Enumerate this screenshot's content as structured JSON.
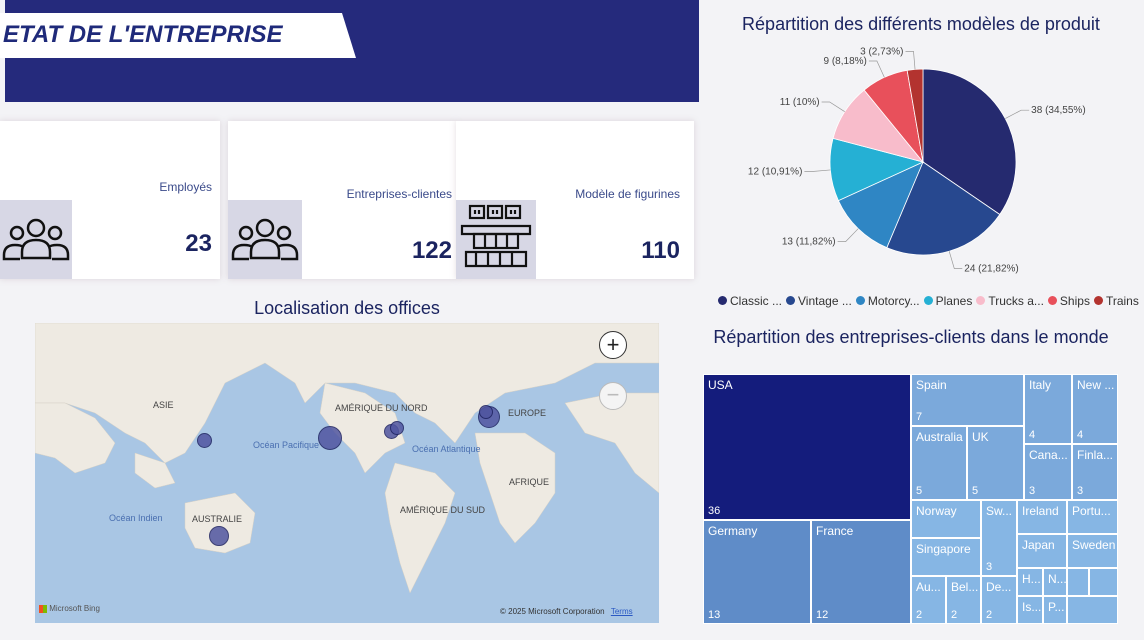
{
  "header": {
    "title": "ETAT DE L'ENTREPRISE"
  },
  "kpis": [
    {
      "label": "Employés",
      "value": "23",
      "icon": "people-icon"
    },
    {
      "label": "Entreprises-clientes",
      "value": "122",
      "icon": "people-icon"
    },
    {
      "label": "Modèle de figurines",
      "value": "110",
      "icon": "product-boxes-icon"
    }
  ],
  "map": {
    "title": "Localisation des offices",
    "labels": {
      "asie": "ASIE",
      "amerique_nord": "AMÉRIQUE DU NORD",
      "europe": "EUROPE",
      "afrique": "AFRIQUE",
      "amerique_sud": "AMÉRIQUE DU SUD",
      "australie": "AUSTRALIE",
      "ocean_pacifique": "Océan Pacifique",
      "ocean_atlantique": "Océan Atlantique",
      "ocean_indien": "Océan Indien"
    },
    "logo": "Microsoft Bing",
    "copyright": "© 2025 Microsoft Corporation",
    "terms": "Terms"
  },
  "pie": {
    "title": "Répartition des différents modèles de produit",
    "legend_colors": [
      "#252a6f",
      "#27488f",
      "#2f86c4",
      "#25b0d4",
      "#f8bccb",
      "#e8505b",
      "#b3332f"
    ]
  },
  "treemap": {
    "title": "Répartition des entreprises-clients dans le monde"
  },
  "chart_data": [
    {
      "type": "pie",
      "title": "Répartition des différents modèles de produit",
      "categories": [
        "Classic ...",
        "Vintage ...",
        "Motorcy...",
        "Planes",
        "Trucks a...",
        "Ships",
        "Trains"
      ],
      "values": [
        38,
        24,
        13,
        12,
        11,
        9,
        3
      ],
      "data_labels": [
        "38 (34,55%)",
        "24 (21,82%)",
        "13 (11,82%)",
        "12 (10,91%)",
        "11 (10%)",
        "9 (8,18%)",
        "3 (2,73%)"
      ],
      "legend": "bottom"
    },
    {
      "type": "treemap",
      "title": "Répartition des entreprises-clients dans le monde",
      "categories": [
        "USA",
        "Germany",
        "France",
        "Spain",
        "Australia",
        "UK",
        "Italy",
        "New ...",
        "Cana...",
        "Finla...",
        "Norway",
        "Singapore",
        "Sw...",
        "Ireland",
        "Portu...",
        "Japan",
        "Sweden",
        "Au...",
        "Bel...",
        "De...",
        "H...",
        "N...",
        "Is...",
        "P..."
      ],
      "values": [
        36,
        13,
        12,
        7,
        5,
        5,
        4,
        4,
        3,
        3,
        2,
        2,
        3,
        2,
        2,
        2,
        2,
        2,
        2,
        2,
        1,
        1,
        1,
        1
      ],
      "printed_values": [
        "36",
        "13",
        "12",
        "7",
        "5",
        "5",
        "4",
        "4",
        "3",
        "3",
        "",
        "",
        "3",
        "",
        "",
        "",
        "",
        "2",
        "2",
        "2",
        "",
        "",
        "",
        ""
      ]
    }
  ]
}
